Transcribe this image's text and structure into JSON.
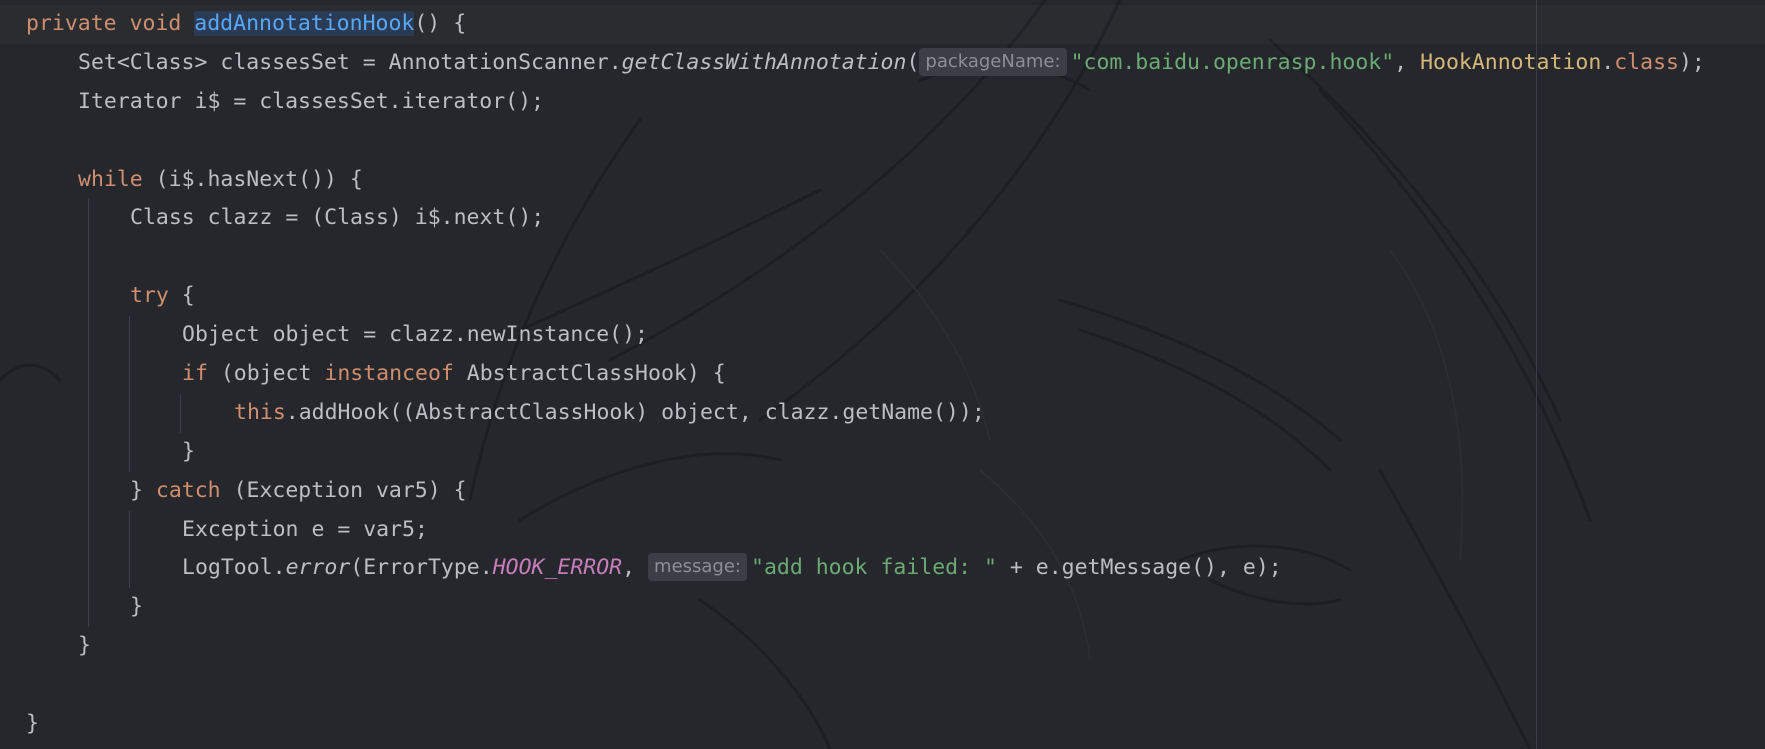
{
  "editor": {
    "language": "Java",
    "colors": {
      "background": "#25272c",
      "keyword": "#cf8e6d",
      "method_declaration": "#56a8f5",
      "string": "#6aab73",
      "static_constant": "#c77dbb",
      "class_reference": "#d5b778",
      "default_text": "#bcbec4",
      "inlay_hint_background": "#3b3e45"
    },
    "lines": [
      {
        "tokens": [
          "private",
          " ",
          "void",
          " ",
          "addAnnotationHook",
          "() {"
        ]
      },
      {
        "tokens": [
          "Set<Class> classesSet = AnnotationScanner.",
          "getClassWithAnnotation",
          "(",
          "packageName:",
          "\"com.baidu.openrasp.hook\"",
          ", ",
          "HookAnnotation",
          ".",
          "class",
          ");"
        ]
      },
      {
        "tokens": [
          "Iterator i$ = classesSet.iterator();"
        ]
      },
      {
        "tokens": []
      },
      {
        "tokens": [
          "while",
          " (i$.hasNext()) {"
        ]
      },
      {
        "tokens": [
          "Class clazz = (Class) i$.next();"
        ]
      },
      {
        "tokens": []
      },
      {
        "tokens": [
          "try",
          " {"
        ]
      },
      {
        "tokens": [
          "Object object = clazz.newInstance();"
        ]
      },
      {
        "tokens": [
          "if",
          " (object ",
          "instanceof",
          " AbstractClassHook) {"
        ]
      },
      {
        "tokens": [
          "this",
          ".addHook((AbstractClassHook) object, clazz.getName());"
        ]
      },
      {
        "tokens": [
          "}"
        ]
      },
      {
        "tokens": [
          "} ",
          "catch",
          " (Exception var5) {"
        ]
      },
      {
        "tokens": [
          "Exception e = var5;"
        ]
      },
      {
        "tokens": [
          "LogTool.",
          "error",
          "(ErrorType.",
          "HOOK_ERROR",
          ", ",
          "message:",
          "\"add hook failed: \"",
          " + e.getMessage(), e);"
        ]
      },
      {
        "tokens": [
          "}"
        ]
      },
      {
        "tokens": [
          "}"
        ]
      },
      {
        "tokens": []
      },
      {
        "tokens": [
          "}"
        ]
      }
    ]
  }
}
